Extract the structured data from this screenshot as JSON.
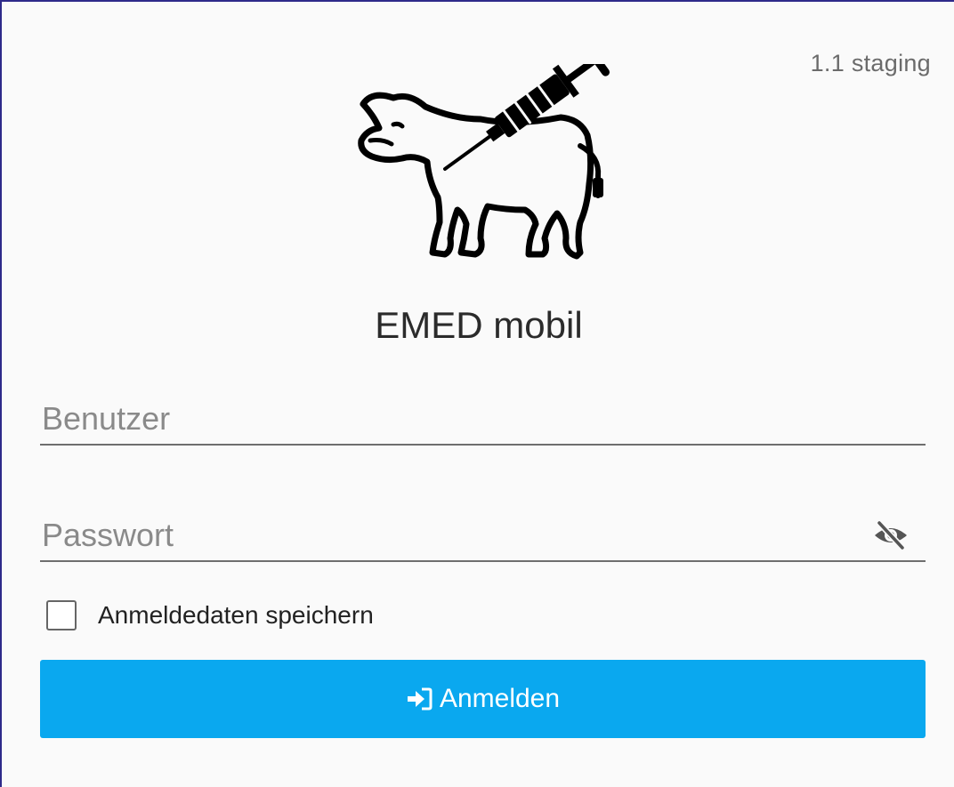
{
  "header": {
    "version": "1.1 staging"
  },
  "app": {
    "title": "EMED mobil",
    "logo_icon": "cow-syringe-icon"
  },
  "form": {
    "username": {
      "value": "",
      "placeholder": "Benutzer"
    },
    "password": {
      "value": "",
      "placeholder": "Passwort",
      "visibility_icon": "eye-slash-icon"
    },
    "remember": {
      "label": "Anmeldedaten speichern",
      "checked": false
    },
    "submit": {
      "label": "Anmelden",
      "icon": "sign-in-icon"
    }
  },
  "colors": {
    "background": "#fafafa",
    "accent": "#0aa8ef",
    "border": "#2e2a8a"
  }
}
